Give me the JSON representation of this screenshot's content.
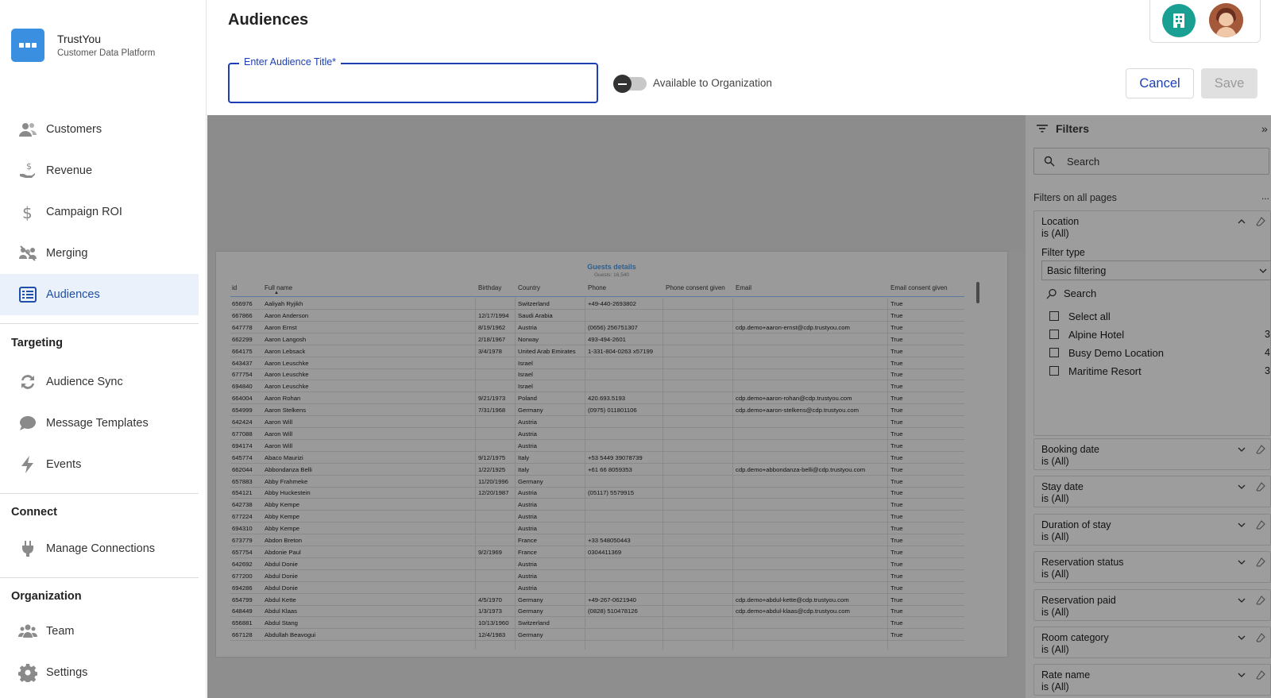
{
  "brand": {
    "name": "TrustYou",
    "subtitle": "Customer Data Platform"
  },
  "nav": {
    "main": [
      {
        "label": "Customers",
        "icon": "customers-icon"
      },
      {
        "label": "Revenue",
        "icon": "revenue-icon"
      },
      {
        "label": "Campaign ROI",
        "icon": "dollar-icon"
      },
      {
        "label": "Merging",
        "icon": "merging-icon"
      },
      {
        "label": "Audiences",
        "icon": "audiences-icon",
        "active": true
      }
    ],
    "targeting_title": "Targeting",
    "targeting": [
      {
        "label": "Audience Sync",
        "icon": "sync-icon"
      },
      {
        "label": "Message Templates",
        "icon": "chat-icon"
      },
      {
        "label": "Events",
        "icon": "lightning-icon"
      }
    ],
    "connect_title": "Connect",
    "connect": [
      {
        "label": "Manage Connections",
        "icon": "plug-icon"
      }
    ],
    "organization_title": "Organization",
    "organization": [
      {
        "label": "Team",
        "icon": "team-icon"
      },
      {
        "label": "Settings",
        "icon": "gear-icon"
      }
    ]
  },
  "header": {
    "title": "Audiences",
    "audience_title_label": "Enter Audience Title*",
    "audience_title_value": "",
    "toggle_label": "Available to Organization",
    "toggle_on": false,
    "cancel_label": "Cancel",
    "save_label": "Save"
  },
  "report": {
    "title": "Guests details",
    "subtitle": "Guests: 16,540",
    "columns": [
      "id",
      "Full name",
      "Birthday",
      "Country",
      "Phone",
      "Phone consent given",
      "Email",
      "Email consent given"
    ],
    "rows": [
      [
        "656976",
        "Aaliyah Ryjikh",
        "",
        "Switzerland",
        "+49-440-2693802",
        "",
        "",
        "True"
      ],
      [
        "667866",
        "Aaron Anderson",
        "12/17/1994",
        "Saudi Arabia",
        "",
        "",
        "",
        "True"
      ],
      [
        "647778",
        "Aaron Ernst",
        "8/19/1962",
        "Austria",
        "(0656) 256751307",
        "",
        "cdp.demo+aaron-ernst@cdp.trustyou.com",
        "True"
      ],
      [
        "662299",
        "Aaron Langosh",
        "2/18/1967",
        "Norway",
        "493-494-2601",
        "",
        "",
        "True"
      ],
      [
        "664175",
        "Aaron Lebsack",
        "3/4/1978",
        "United Arab Emirates",
        "1-331-804-0263 x57199",
        "",
        "",
        "True"
      ],
      [
        "643437",
        "Aaron Leuschke",
        "",
        "Israel",
        "",
        "",
        "",
        "True"
      ],
      [
        "677754",
        "Aaron Leuschke",
        "",
        "Israel",
        "",
        "",
        "",
        "True"
      ],
      [
        "694840",
        "Aaron Leuschke",
        "",
        "Israel",
        "",
        "",
        "",
        "True"
      ],
      [
        "664004",
        "Aaron Rohan",
        "9/21/1973",
        "Poland",
        "420.693.5193",
        "",
        "cdp.demo+aaron-rohan@cdp.trustyou.com",
        "True"
      ],
      [
        "654999",
        "Aaron Stelkens",
        "7/31/1968",
        "Germany",
        "(0975) 011801106",
        "",
        "cdp.demo+aaron-stelkens@cdp.trustyou.com",
        "True"
      ],
      [
        "642424",
        "Aaron Will",
        "",
        "Austria",
        "",
        "",
        "",
        "True"
      ],
      [
        "677088",
        "Aaron Will",
        "",
        "Austria",
        "",
        "",
        "",
        "True"
      ],
      [
        "694174",
        "Aaron Will",
        "",
        "Austria",
        "",
        "",
        "",
        "True"
      ],
      [
        "645774",
        "Abaco Maurizi",
        "9/12/1975",
        "Italy",
        "+53 5449 39078739",
        "",
        "",
        "True"
      ],
      [
        "662044",
        "Abbondanza Belli",
        "1/22/1925",
        "Italy",
        "+61 66 8059353",
        "",
        "cdp.demo+abbondanza-belli@cdp.trustyou.com",
        "True"
      ],
      [
        "657883",
        "Abby Frahmeke",
        "11/20/1996",
        "Germany",
        "",
        "",
        "",
        "True"
      ],
      [
        "654121",
        "Abby Huckestein",
        "12/20/1987",
        "Austria",
        "(05117) 5579915",
        "",
        "",
        "True"
      ],
      [
        "642738",
        "Abby Kempe",
        "",
        "Austria",
        "",
        "",
        "",
        "True"
      ],
      [
        "677224",
        "Abby Kempe",
        "",
        "Austria",
        "",
        "",
        "",
        "True"
      ],
      [
        "694310",
        "Abby Kempe",
        "",
        "Austria",
        "",
        "",
        "",
        "True"
      ],
      [
        "673779",
        "Abdon Breton",
        "",
        "France",
        "+33 548050443",
        "",
        "",
        "True"
      ],
      [
        "657754",
        "Abdonie Paul",
        "9/2/1969",
        "France",
        "0304411369",
        "",
        "",
        "True"
      ],
      [
        "642692",
        "Abdul Donie",
        "",
        "Austria",
        "",
        "",
        "",
        "True"
      ],
      [
        "677200",
        "Abdul Donie",
        "",
        "Austria",
        "",
        "",
        "",
        "True"
      ],
      [
        "694286",
        "Abdul Donie",
        "",
        "Austria",
        "",
        "",
        "",
        "True"
      ],
      [
        "654799",
        "Abdul Kette",
        "4/5/1970",
        "Germany",
        "+49-267-0621940",
        "",
        "cdp.demo+abdul-kette@cdp.trustyou.com",
        "True"
      ],
      [
        "648449",
        "Abdul Klaas",
        "1/3/1973",
        "Germany",
        "(0828) 510478126",
        "",
        "cdp.demo+abdul-klaas@cdp.trustyou.com",
        "True"
      ],
      [
        "656881",
        "Abdul Stang",
        "10/13/1960",
        "Switzerland",
        "",
        "",
        "",
        "True"
      ],
      [
        "667128",
        "Abdullah Beavogui",
        "12/4/1983",
        "Germany",
        "",
        "",
        "",
        "True"
      ]
    ]
  },
  "filters": {
    "title": "Filters",
    "search_placeholder": "Search",
    "section_title": "Filters on all pages",
    "more": "...",
    "location": {
      "title": "Location",
      "value": "is (All)",
      "filter_type_label": "Filter type",
      "filter_type_value": "Basic filtering",
      "search_label": "Search",
      "options": [
        {
          "label": "Select all",
          "count": ""
        },
        {
          "label": "Alpine Hotel",
          "count": "3"
        },
        {
          "label": "Busy Demo Location",
          "count": "4"
        },
        {
          "label": "Maritime Resort",
          "count": "3"
        }
      ]
    },
    "cards": [
      {
        "title": "Booking date",
        "value": "is (All)"
      },
      {
        "title": "Stay date",
        "value": "is (All)"
      },
      {
        "title": "Duration of stay",
        "value": "is (All)"
      },
      {
        "title": "Reservation status",
        "value": "is (All)"
      },
      {
        "title": "Reservation paid",
        "value": "is (All)"
      },
      {
        "title": "Room category",
        "value": "is (All)"
      },
      {
        "title": "Rate name",
        "value": "is (All)"
      }
    ]
  }
}
